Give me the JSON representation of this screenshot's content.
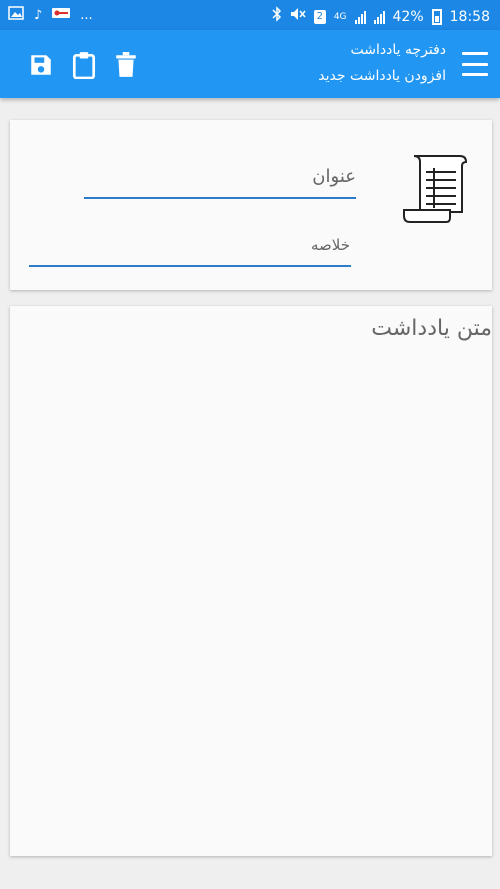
{
  "status_bar": {
    "left_icons": [
      "image-icon",
      "music-note-icon",
      "key-icon",
      "more-dots-icon"
    ],
    "more_text": "...",
    "sim_badge": "2",
    "network": "4G",
    "battery_text": "42%",
    "time": "18:58"
  },
  "toolbar": {
    "title": "دفترچه یادداشت",
    "subtitle": "افزودن یادداشت جدید",
    "actions": [
      "save-icon",
      "clipboard-icon",
      "trash-icon"
    ]
  },
  "form": {
    "title_label": "عنوان",
    "summary_label": "خلاصه",
    "body_label": "متن یادداشت"
  },
  "colors": {
    "statusbar": "#1c87e5",
    "toolbar": "#2196f3",
    "underline": "#2e7cc9",
    "background": "#efefef",
    "card": "#fafafa"
  }
}
